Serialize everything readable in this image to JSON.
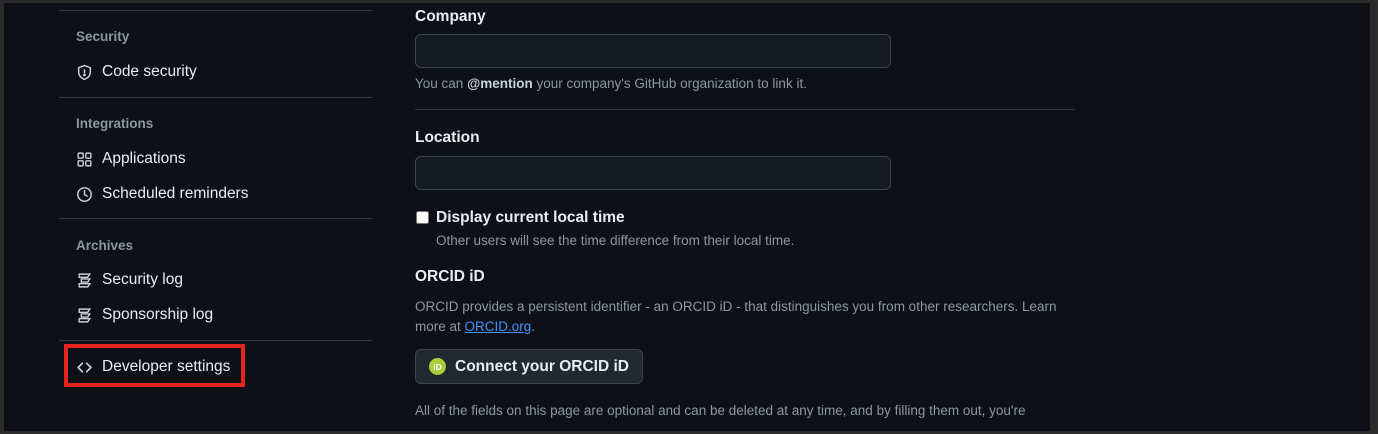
{
  "sidebar": {
    "security": {
      "title": "Security",
      "items": [
        {
          "label": "Code security",
          "icon": "shield-icon"
        }
      ]
    },
    "integrations": {
      "title": "Integrations",
      "items": [
        {
          "label": "Applications",
          "icon": "apps-icon"
        },
        {
          "label": "Scheduled reminders",
          "icon": "clock-icon"
        }
      ]
    },
    "archives": {
      "title": "Archives",
      "items": [
        {
          "label": "Security log",
          "icon": "log-icon"
        },
        {
          "label": "Sponsorship log",
          "icon": "log-icon"
        }
      ]
    },
    "developer": {
      "label": "Developer settings",
      "icon": "code-icon",
      "highlight_color": "#e7241c"
    }
  },
  "form": {
    "company": {
      "label": "Company",
      "value": "",
      "hint_prefix": "You can ",
      "hint_mention": "@mention",
      "hint_suffix": " your company's GitHub organization to link it."
    },
    "location": {
      "label": "Location",
      "value": ""
    },
    "local_time": {
      "label": "Display current local time",
      "checked": false,
      "hint": "Other users will see the time difference from their local time."
    },
    "orcid": {
      "title": "ORCID iD",
      "description_line1": "ORCID provides a persistent identifier - an ORCID iD - that distinguishes you from other researchers. Learn",
      "description_prefix": "more at ",
      "link_text": "ORCID.org",
      "description_suffix": ".",
      "button_label": "Connect your ORCID iD",
      "badge_text": "iD",
      "badge_color": "#a6ce39"
    },
    "footer_text": "All of the fields on this page are optional and can be deleted at any time, and by filling them out, you're"
  },
  "colors": {
    "background": "#0d1117",
    "accent_link": "#4493f8",
    "muted_text": "#8d96a0"
  }
}
